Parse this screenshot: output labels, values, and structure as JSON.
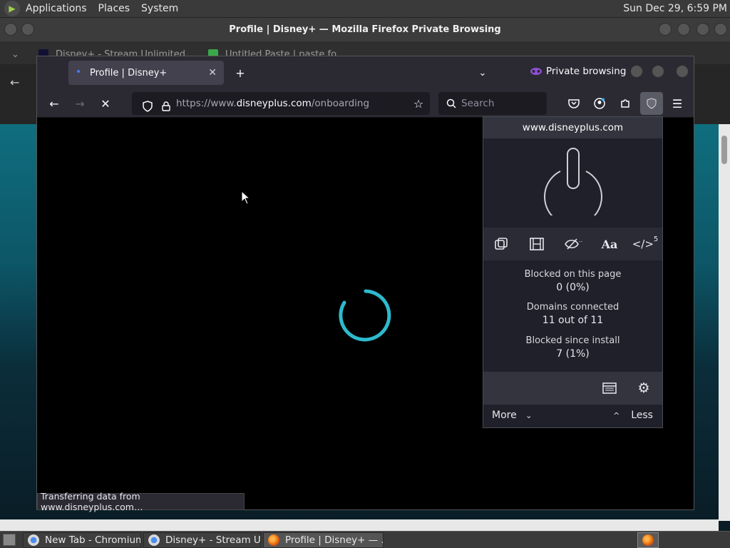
{
  "top_panel": {
    "menus": [
      "Applications",
      "Places",
      "System"
    ],
    "clock": "Sun Dec 29,  6:59 PM"
  },
  "outer_window": {
    "title": "Profile | Disney+ — Mozilla Firefox Private Browsing",
    "tabs": [
      {
        "label": "Disney+ - Stream Unlimited"
      },
      {
        "label": "Untitled Paste | paste fo"
      }
    ]
  },
  "firefox": {
    "tab_title": "Profile | Disney+",
    "private_label": "Private browsing",
    "url_prefix": "https://www.",
    "url_host": "disneyplus.com",
    "url_path": "/onboarding",
    "search_placeholder": "Search",
    "status_text": "Transferring data from www.disneyplus.com…"
  },
  "ublock": {
    "hostname": "www.disneyplus.com",
    "script_count": "5",
    "font_tool_label": "Aa",
    "stats": {
      "blocked_page_label": "Blocked on this page",
      "blocked_page_value": "0 (0%)",
      "domains_label": "Domains connected",
      "domains_value": "11 out of 11",
      "blocked_install_label": "Blocked since install",
      "blocked_install_value": "7 (1%)"
    },
    "more_label": "More",
    "less_label": "Less"
  },
  "taskbar": {
    "items": [
      {
        "label": "New Tab - Chromium"
      },
      {
        "label": "Disney+ - Stream U..."
      },
      {
        "label": "Profile | Disney+ — ..."
      }
    ]
  },
  "colors": {
    "accent_private": "#8f4fd8",
    "spinner": "#2fc4d8",
    "panel_bg": "#3a3a3a"
  }
}
